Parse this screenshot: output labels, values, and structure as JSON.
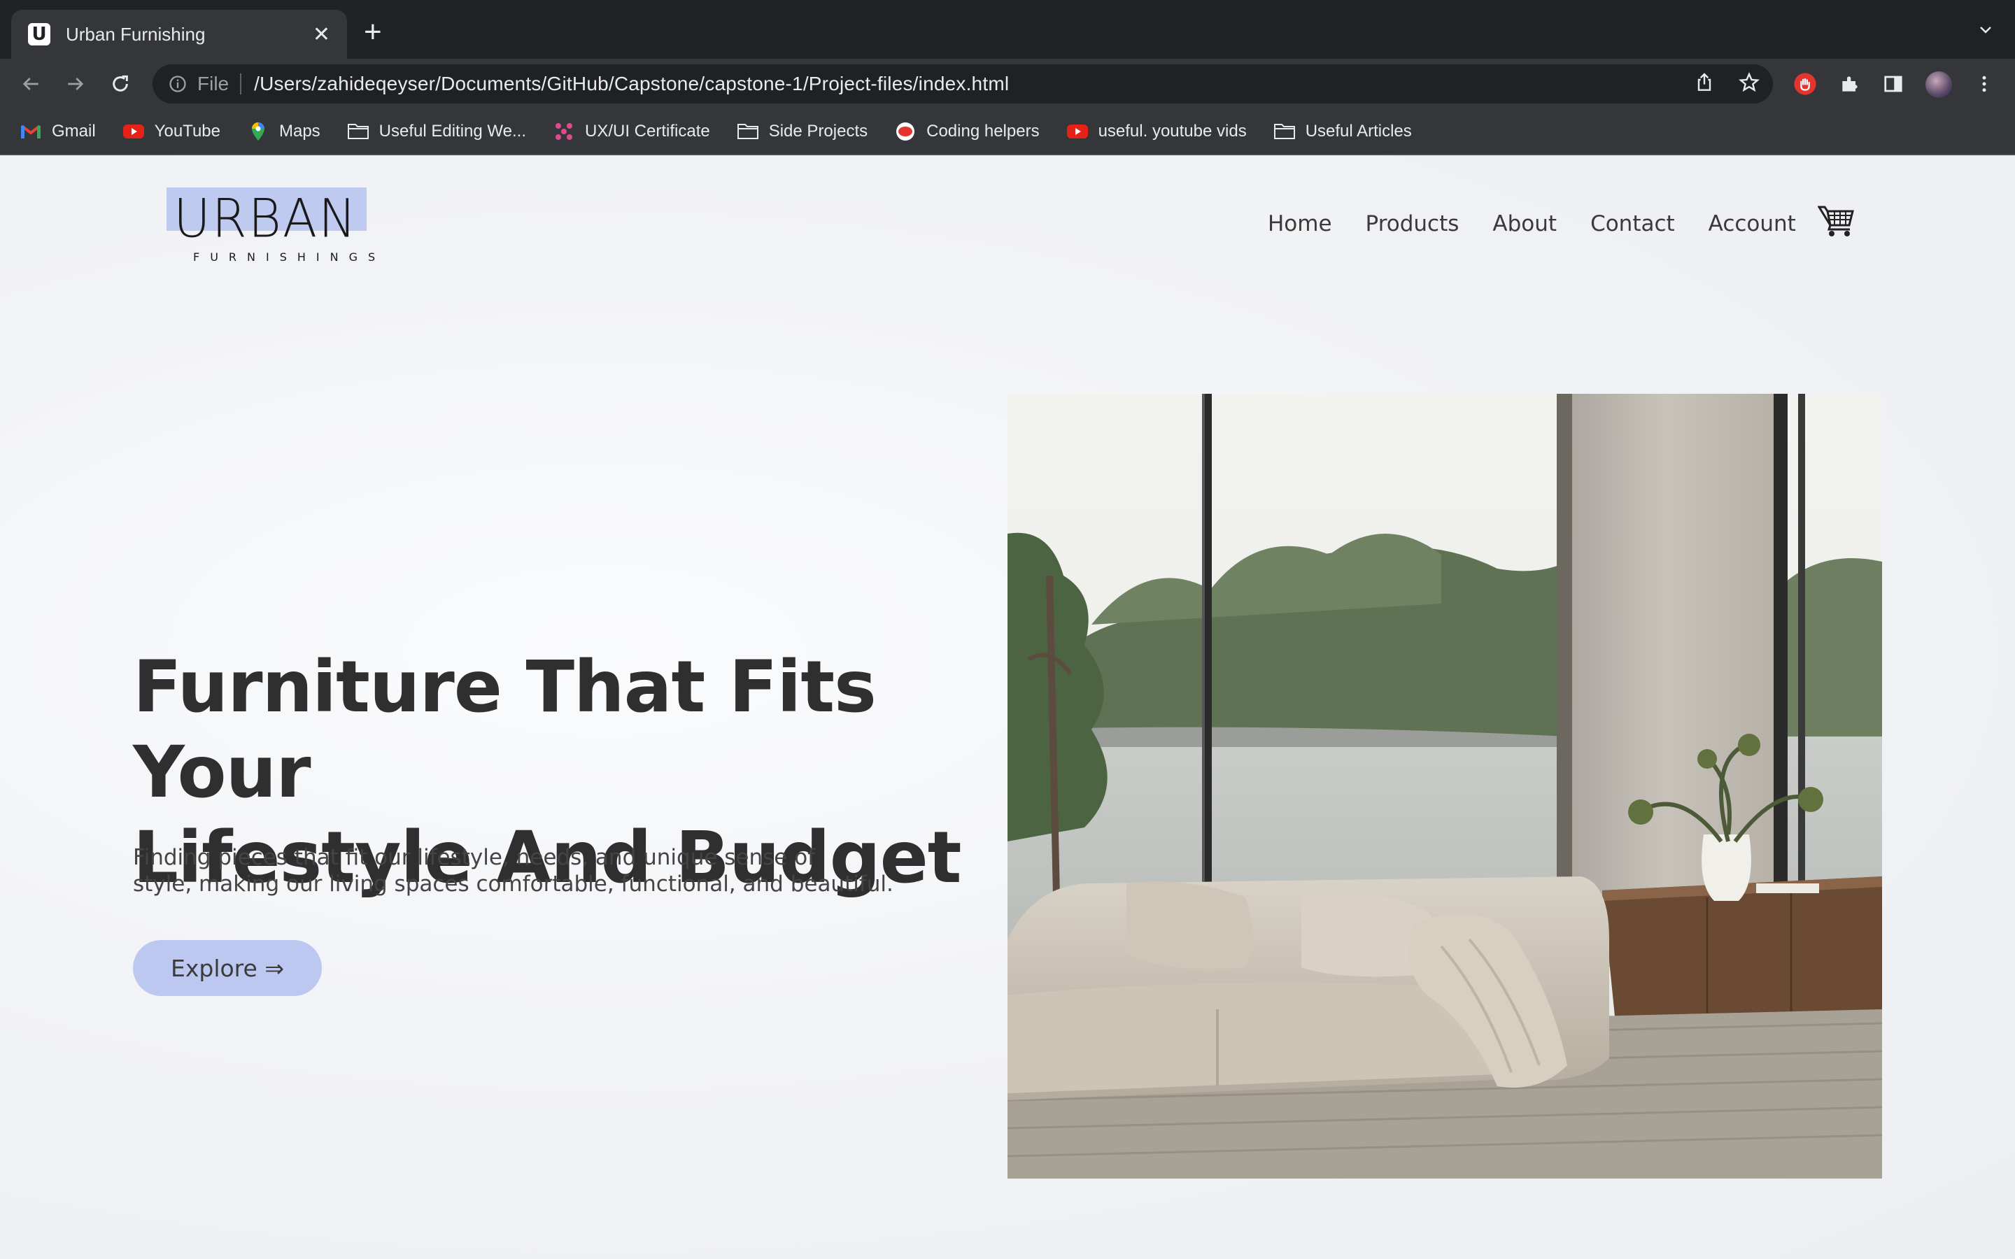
{
  "browser": {
    "tab_title": "Urban Furnishing",
    "favicon_letter": "U",
    "url_scheme_label": "File",
    "url": "/Users/zahideqeyser/Documents/GitHub/Capstone/capstone-1/Project-files/index.html",
    "bookmarks": [
      {
        "label": "Gmail",
        "icon": "gmail-icon"
      },
      {
        "label": "YouTube",
        "icon": "youtube-icon"
      },
      {
        "label": "Maps",
        "icon": "maps-icon"
      },
      {
        "label": "Useful Editing We...",
        "icon": "folder-icon"
      },
      {
        "label": "UX/UI Certificate",
        "icon": "dots-icon"
      },
      {
        "label": "Side Projects",
        "icon": "folder-icon"
      },
      {
        "label": "Coding helpers",
        "icon": "record-icon"
      },
      {
        "label": "useful. youtube vids",
        "icon": "youtube-icon"
      },
      {
        "label": "Useful Articles",
        "icon": "folder-icon"
      }
    ]
  },
  "site": {
    "logo_text": "URBAN",
    "logo_subtext": "FURNISHINGS",
    "nav": [
      "Home",
      "Products",
      "About",
      "Contact",
      "Account"
    ],
    "cart_icon": "cart-icon",
    "hero": {
      "title_line1": "Furniture That Fits Your",
      "title_line2": "Lifestyle And Budget",
      "subtitle_line1": "Finding pieces that fit our lifestyle, needs, and unique sense of",
      "subtitle_line2": "style, making our living spaces comfortable, functional, and beautiful.",
      "cta": "Explore ⇒"
    }
  },
  "colors": {
    "accent": "#bcc8f0",
    "chrome_dark": "#202124",
    "chrome_mid": "#35363a"
  }
}
